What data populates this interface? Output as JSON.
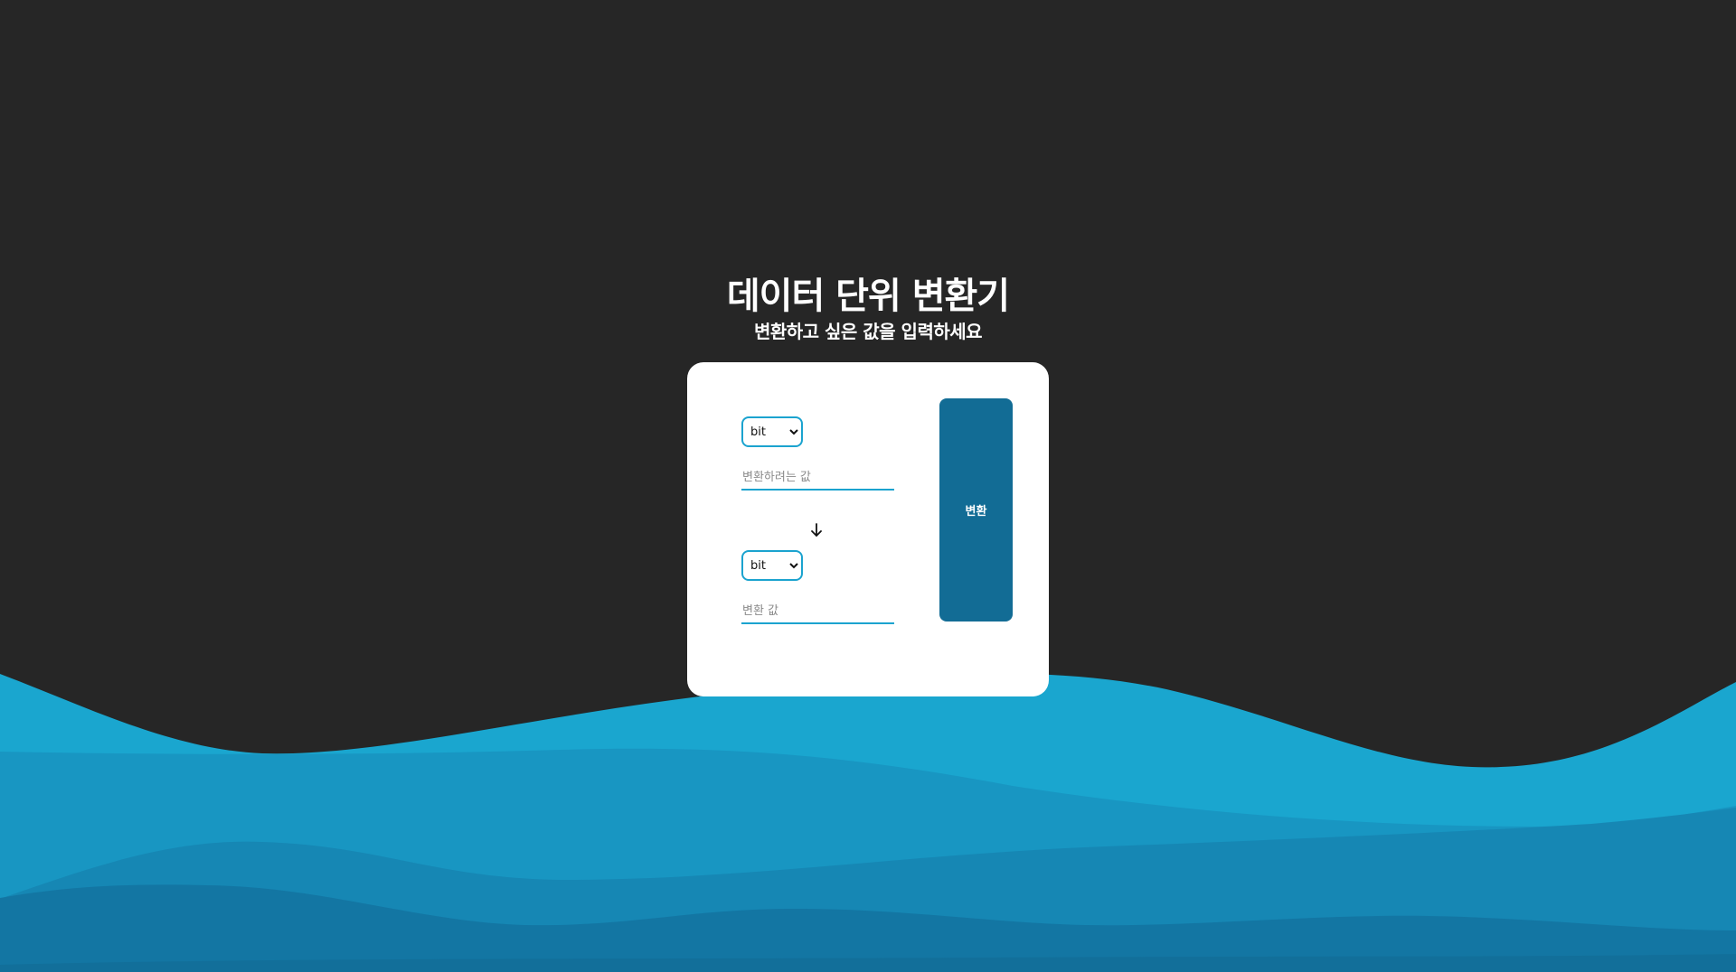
{
  "header": {
    "title": "데이터 단위 변환기",
    "subtitle": "변환하고 싶은 값을 입력하세요"
  },
  "converter": {
    "from_unit": {
      "selected": "bit"
    },
    "from_value": {
      "value": "",
      "placeholder": "변환하려는 값"
    },
    "arrow_icon": "arrow-down-icon",
    "to_unit": {
      "selected": "bit"
    },
    "to_value": {
      "value": "",
      "placeholder": "변환 값"
    },
    "convert_label": "변환"
  },
  "colors": {
    "background": "#262626",
    "card": "#ffffff",
    "accent": "#1ba3cf",
    "button": "#126c95",
    "wave_1": "#1aa6cf",
    "wave_2": "#1896c2",
    "wave_3": "#1687b4",
    "wave_4": "#1376a3"
  }
}
